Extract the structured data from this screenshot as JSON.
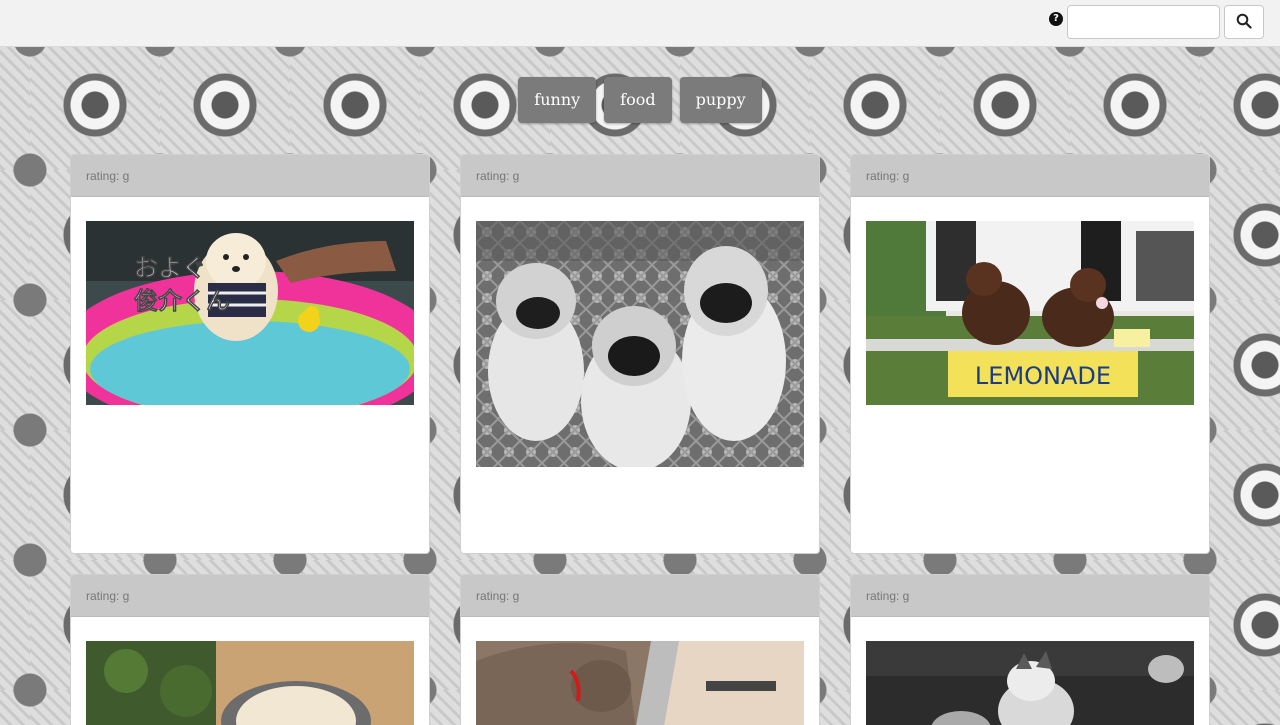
{
  "navbar": {
    "help_glyph": "?",
    "search_placeholder": "",
    "search_value": "",
    "search_icon": "search-icon"
  },
  "tags": [
    {
      "label": "funny"
    },
    {
      "label": "food"
    },
    {
      "label": "puppy"
    }
  ],
  "cards": [
    {
      "rating": "rating: g",
      "image_text": "およぐ 俊介くん",
      "image_icon": "pomeranian-pool-image"
    },
    {
      "rating": "rating: g",
      "image_icon": "three-pugs-image"
    },
    {
      "rating": "rating: g",
      "image_text": "LEMONADE",
      "image_icon": "dachshunds-lemonade-image"
    },
    {
      "rating": "rating: g",
      "image_icon": "dog-in-bowl-image"
    },
    {
      "rating": "rating: g",
      "image_icon": "pitbull-image"
    },
    {
      "rating": "rating: g",
      "image_icon": "husky-puppy-image"
    }
  ]
}
